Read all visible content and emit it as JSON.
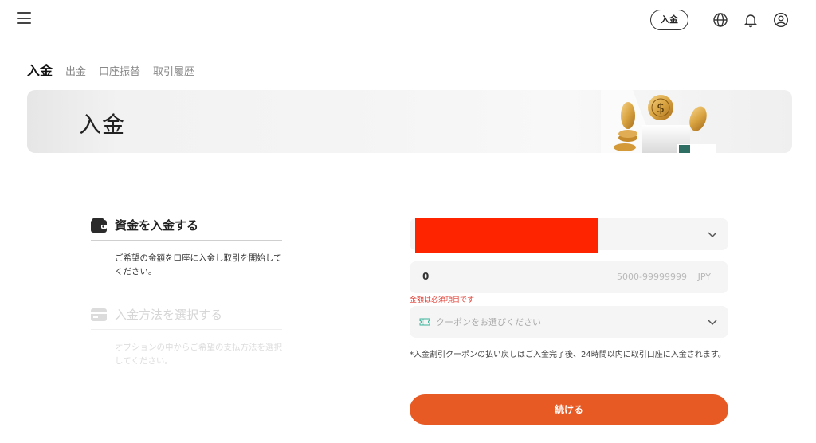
{
  "header": {
    "menu_icon": "hamburger-menu-icon",
    "deposit_button_label": "入金",
    "icons": [
      "globe-icon",
      "bell-icon",
      "user-icon"
    ]
  },
  "tabs": [
    {
      "label": "入金",
      "active": true
    },
    {
      "label": "出金",
      "active": false
    },
    {
      "label": "口座振替",
      "active": false
    },
    {
      "label": "取引履歴",
      "active": false
    }
  ],
  "banner": {
    "title": "入金"
  },
  "steps": [
    {
      "title": "資金を入金する",
      "description": "ご希望の金額を口座に入金し取引を開始してください。",
      "icon": "wallet-icon",
      "active": true
    },
    {
      "title": "入金方法を選択する",
      "description": "オプションの中からご希望の支払方法を選択してください。",
      "icon": "credit-card-icon",
      "active": false
    }
  ],
  "form": {
    "account_select": {
      "value_redacted": true,
      "icon": "chevron-down-icon"
    },
    "amount": {
      "value": "0",
      "range_hint": "5000-99999999",
      "currency": "JPY"
    },
    "amount_error": "金額は必須項目です",
    "coupon": {
      "placeholder": "クーポンをお選びください",
      "icon": "ticket-icon"
    },
    "note": "*入金割引クーポンの払い戻しはご入金完了後、24時間以内に取引口座に入金されます。",
    "continue_label": "続ける"
  },
  "colors": {
    "accent": "#e85a24",
    "error": "#e03a2f",
    "redaction": "#ff2400"
  }
}
